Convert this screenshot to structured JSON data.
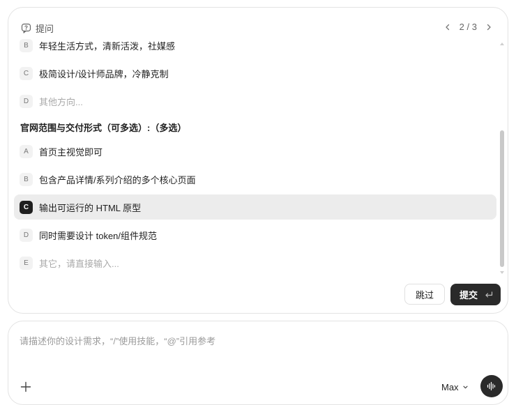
{
  "header": {
    "title": "提问",
    "page_current": "2",
    "page_separator": "/",
    "page_total": "3"
  },
  "question1": {
    "options": [
      {
        "key": "B",
        "label": "年轻生活方式，清新活泼，社媒感"
      },
      {
        "key": "C",
        "label": "极简设计/设计师品牌，冷静克制"
      },
      {
        "key": "D",
        "label": "其他方向..."
      }
    ]
  },
  "question2": {
    "heading": "官网范围与交付形式（可多选）:（多选）",
    "options": [
      {
        "key": "A",
        "label": "首页主视觉即可"
      },
      {
        "key": "B",
        "label": "包含产品详情/系列介绍的多个核心页面"
      },
      {
        "key": "C",
        "label": "输出可运行的 HTML 原型",
        "selected": true
      },
      {
        "key": "D",
        "label": "同时需要设计 token/组件规范"
      },
      {
        "key": "E",
        "label": "其它，请直接输入..."
      }
    ]
  },
  "actions": {
    "skip_label": "跳过",
    "submit_label": "提交"
  },
  "composer": {
    "placeholder": "请描述你的设计需求，“/”使用技能，“@”引用参考",
    "model_label": "Max"
  },
  "icons": {
    "title": "question-bubble-icon",
    "prev": "chevron-left-icon",
    "next": "chevron-right-icon",
    "submit": "enter-return-icon",
    "add": "plus-icon",
    "model": "chevron-down-icon",
    "voice": "waveform-icon"
  },
  "colors": {
    "selected_row": "#ececec",
    "selected_key": "#1f1f1f",
    "primary_button": "#2a2a2a",
    "placeholder_text": "#9a9a9a"
  }
}
